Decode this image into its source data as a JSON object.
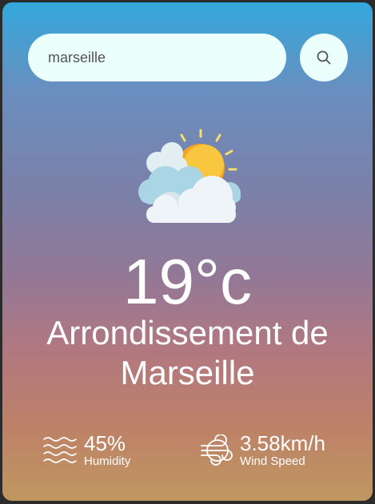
{
  "search": {
    "value": "marseille",
    "button_icon": "search-icon"
  },
  "weather": {
    "icon": "partly-cloudy-sun-icon",
    "temperature": "19°c",
    "city": "Arrondissement de Marseille"
  },
  "details": {
    "humidity": {
      "value": "45%",
      "label": "Humidity",
      "icon": "humidity-waves-icon"
    },
    "wind": {
      "value": "3.58km/h",
      "label": "Wind Speed",
      "icon": "wind-icon"
    }
  },
  "colors": {
    "gradient_top": "#33a8dc",
    "gradient_mid": "#937896",
    "gradient_bottom": "#c09760",
    "input_background": "#ebfffc",
    "text": "#ffffff"
  }
}
